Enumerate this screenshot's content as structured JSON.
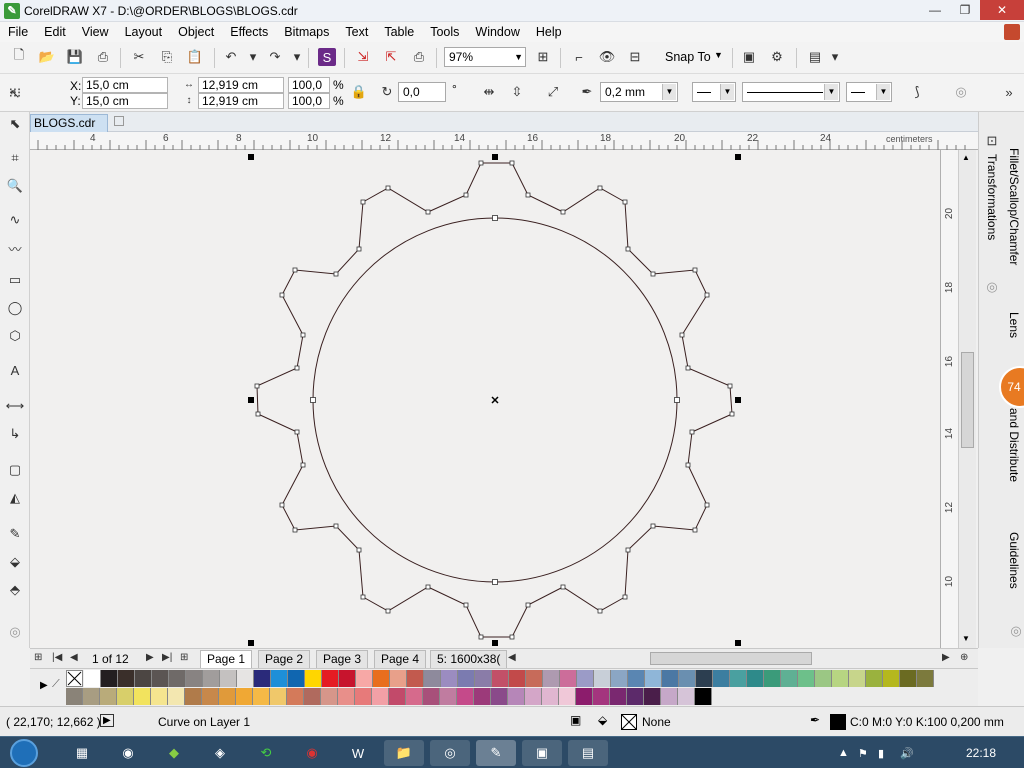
{
  "titlebar": {
    "title": "CorelDRAW X7 - D:\\@ORDER\\BLOGS\\BLOGS.cdr",
    "minimize": "—",
    "restore": "❐",
    "close": "✕"
  },
  "menubar": [
    "File",
    "Edit",
    "View",
    "Layout",
    "Object",
    "Effects",
    "Bitmaps",
    "Text",
    "Table",
    "Tools",
    "Window",
    "Help"
  ],
  "toolbar": {
    "zoom": "97%",
    "snap_to": "Snap To"
  },
  "properties": {
    "x": "15,0 cm",
    "y": "15,0 cm",
    "x_label": "X:",
    "y_label": "Y:",
    "width": "12,919 cm",
    "height": "12,919 cm",
    "scale_w": "100,0",
    "scale_h": "100,0",
    "percent": "%",
    "rotation": "0,0",
    "degree": "°",
    "outline_width": "0,2 mm"
  },
  "document": {
    "tab": "BLOGS.cdr"
  },
  "ruler_h": {
    "numbers": [
      "4",
      "6",
      "8",
      "10",
      "12",
      "14",
      "16",
      "18",
      "20",
      "22",
      "24"
    ],
    "unit": "centimeters"
  },
  "ruler_v": {
    "numbers": [
      "20",
      "18",
      "16",
      "14",
      "12",
      "10"
    ],
    "unit": "centimeters"
  },
  "dockers": {
    "tabs": [
      "Transformations",
      "Fillet/Scallop/Chamfer",
      "Lens",
      "and Distribute",
      "Guidelines"
    ],
    "badge": "74"
  },
  "pages": {
    "count": "1 of 12",
    "tabs": [
      "Page 1",
      "Page 2",
      "Page 3",
      "Page 4",
      "5: 1600x38("
    ],
    "active": "Page 1"
  },
  "palette": {
    "row1": [
      "#ffffff",
      "#231f20",
      "#3a2f2a",
      "#4c4643",
      "#5b5553",
      "#6f6a68",
      "#888382",
      "#a19d9c",
      "#c4c1c0",
      "#e6e4e3",
      "#2a2a7a",
      "#1e8fd8",
      "#1066b0",
      "#ffd600",
      "#e51c23",
      "#c7142d",
      "#f7a8a6",
      "#e86e1e",
      "#e8a08a",
      "#c25a4e",
      "#8e8a9c",
      "#9b8cc0",
      "#7b7bb0",
      "#8a7ca8",
      "#c25068",
      "#c24a4a",
      "#c76b5a",
      "#ae9ab0",
      "#cc6d9a",
      "#9b9bc7",
      "#c8cfd8",
      "#8ba6c4",
      "#5a86b2",
      "#8fb6d8",
      "#4b78a4",
      "#6a8fb0",
      "#2c3e50",
      "#3c7ea0",
      "#4aa0a0",
      "#2e8a8a",
      "#3b9b7a",
      "#5fb094",
      "#6dc08a",
      "#9bc784",
      "#b7d582",
      "#c7d58b",
      "#9ab23e",
      "#b5b81e",
      "#6b6b22",
      "#7c7a3d"
    ],
    "row2": [
      "#8a8378",
      "#a89d82",
      "#b9ab7a",
      "#d8cf6a",
      "#f2e35e",
      "#f5e58f",
      "#f3e7b0",
      "#b07b4a",
      "#c7884b",
      "#e09a3a",
      "#f0a834",
      "#f5b946",
      "#f0c86a",
      "#d47a5a",
      "#b06a5e",
      "#d6968a",
      "#e88f8a",
      "#e77a7a",
      "#f2a0a6",
      "#c24a6a",
      "#d66a8c",
      "#a8507a",
      "#c07ca0",
      "#c54a8a",
      "#9c3a7a",
      "#8a4a8a",
      "#b686b8",
      "#d4a6c8",
      "#e0b6d0",
      "#f0c8d8",
      "#8c1c6c",
      "#a4357e",
      "#7a2870",
      "#5c2a6a",
      "#4a1e4a",
      "#c6a8c8",
      "#d6c4d8",
      "#000000"
    ]
  },
  "status": {
    "coords": "( 22,170; 12,662 )",
    "layer": "Curve on Layer 1",
    "fill": "None",
    "outline": "C:0 M:0 Y:0 K:100  0,200 mm"
  },
  "taskbar": {
    "time": "22:18"
  }
}
